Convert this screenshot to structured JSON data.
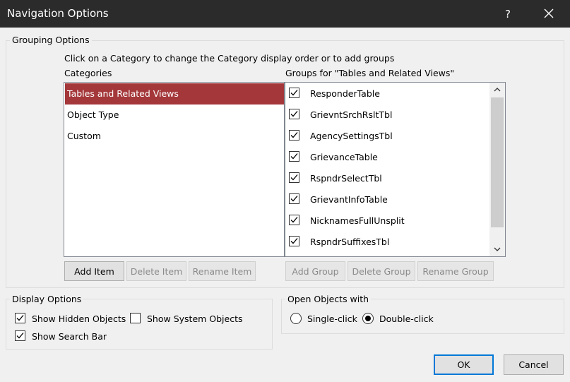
{
  "window": {
    "title": "Navigation Options",
    "help_label": "?"
  },
  "grouping": {
    "legend": "Grouping Options",
    "instruction": "Click on a Category to change the Category display order or to add groups",
    "categories_label": "Categories",
    "categories": [
      {
        "label": "Tables and Related Views",
        "selected": true
      },
      {
        "label": "Object Type",
        "selected": false
      },
      {
        "label": "Custom",
        "selected": false
      }
    ],
    "groups_label": "Groups for \"Tables and Related Views\"",
    "groups": [
      {
        "label": "ResponderTable",
        "checked": true
      },
      {
        "label": "GrievntSrchRsltTbl",
        "checked": true
      },
      {
        "label": "AgencySettingsTbl",
        "checked": true
      },
      {
        "label": "GrievanceTable",
        "checked": true
      },
      {
        "label": "RspndrSelectTbl",
        "checked": true
      },
      {
        "label": "GrievantInfoTable",
        "checked": true
      },
      {
        "label": "NicknamesFullUnsplit",
        "checked": true
      },
      {
        "label": "RspndrSuffixesTbl",
        "checked": true
      }
    ],
    "buttons": {
      "add_item": "Add Item",
      "delete_item": "Delete Item",
      "rename_item": "Rename Item",
      "add_group": "Add Group",
      "delete_group": "Delete Group",
      "rename_group": "Rename Group"
    }
  },
  "display": {
    "legend": "Display Options",
    "show_hidden": {
      "label": "Show Hidden Objects",
      "checked": true
    },
    "show_system": {
      "label": "Show System Objects",
      "checked": false
    },
    "show_search": {
      "label": "Show Search Bar",
      "checked": true
    }
  },
  "open_with": {
    "legend": "Open Objects with",
    "single_click": {
      "label": "Single-click",
      "selected": false
    },
    "double_click": {
      "label": "Double-click",
      "selected": true
    }
  },
  "footer": {
    "ok": "OK",
    "cancel": "Cancel"
  },
  "colors": {
    "selection": "#a4373a",
    "titlebar": "#2b2b2b"
  }
}
